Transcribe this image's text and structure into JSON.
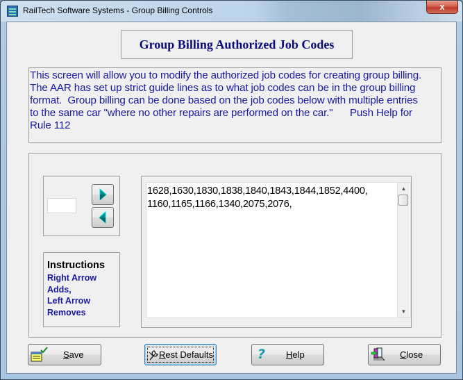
{
  "window": {
    "title": "RailTech Software Systems - Group Billing Controls",
    "close_label": "x"
  },
  "header": {
    "title": "Group Billing Authorized Job Codes"
  },
  "description": {
    "text": "This screen will allow you to modify the authorized job codes for creating group billing.\nThe AAR has set up strict guide lines as to what job codes can be in the group billing\nformat.  Group billing can be done based on the job codes below with multiple entries\nto the same car \"where no other repairs are performed on the car.\"      Push Help for\nRule 112"
  },
  "entry": {
    "code_value": "",
    "add_button": "right-arrow",
    "remove_button": "left-arrow"
  },
  "instructions": {
    "title": "Instructions",
    "lines": [
      "Right Arrow",
      "Adds,",
      "Left Arrow",
      "Removes"
    ]
  },
  "codes": {
    "text": "1628,1630,1830,1838,1840,1843,1844,1852,4400,\n1160,1165,1166,1340,2075,2076,"
  },
  "buttons": {
    "save": {
      "accel": "S",
      "rest": "ave"
    },
    "rest_defaults": {
      "accel": "R",
      "rest": "est Defaults"
    },
    "help": {
      "accel": "H",
      "rest": "elp"
    },
    "close": {
      "accel": "C",
      "rest": "lose"
    }
  }
}
